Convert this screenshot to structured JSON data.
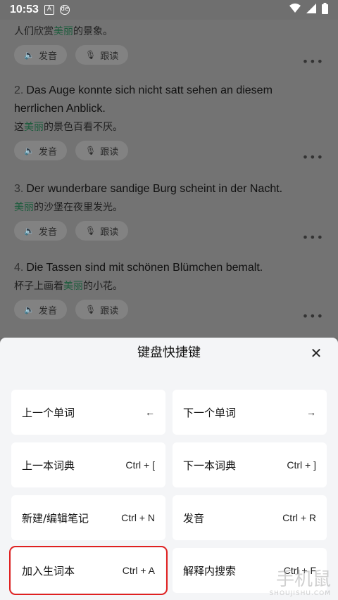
{
  "status": {
    "time": "10:53",
    "icon_a": "A",
    "icon_b": "de"
  },
  "examples": [
    {
      "num": "",
      "de": "",
      "zh_pre": "人们欣赏",
      "zh_hl": "美丽",
      "zh_post": "的景象。"
    },
    {
      "num": "2.",
      "de": "Das Auge konnte sich nicht satt sehen an diesem herrlichen Anblick.",
      "zh_pre": "这",
      "zh_hl": "美丽",
      "zh_post": "的景色百看不厌。"
    },
    {
      "num": "3.",
      "de": "Der wunderbare sandige Burg scheint in der Nacht.",
      "zh_pre": "",
      "zh_hl": "美丽",
      "zh_post": "的沙堡在夜里发光。"
    },
    {
      "num": "4.",
      "de": "Die Tassen sind mit schönen Blümchen bemalt.",
      "zh_pre": "杯子上画着",
      "zh_hl": "美丽",
      "zh_post": "的小花。"
    }
  ],
  "chips": {
    "pronounce": "发音",
    "follow": "跟读"
  },
  "more_glyph": "•••",
  "sheet": {
    "title": "键盘快捷键",
    "close": "✕",
    "shortcuts": [
      {
        "label": "上一个单词",
        "key": "←"
      },
      {
        "label": "下一个单词",
        "key": "→"
      },
      {
        "label": "上一本词典",
        "key": "Ctrl + ["
      },
      {
        "label": "下一本词典",
        "key": "Ctrl + ]"
      },
      {
        "label": "新建/编辑笔记",
        "key": "Ctrl + N"
      },
      {
        "label": "发音",
        "key": "Ctrl + R"
      },
      {
        "label": "加入生词本",
        "key": "Ctrl + A"
      },
      {
        "label": "解释内搜索",
        "key": "Ctrl + F"
      }
    ]
  },
  "watermark": {
    "main": "手机鼠",
    "sub": "SHOUJISHU.COM"
  },
  "colors": {
    "highlight_text": "#1c5c3c",
    "highlight_box": "#e02020",
    "sheet_bg": "#f4f5f7"
  }
}
